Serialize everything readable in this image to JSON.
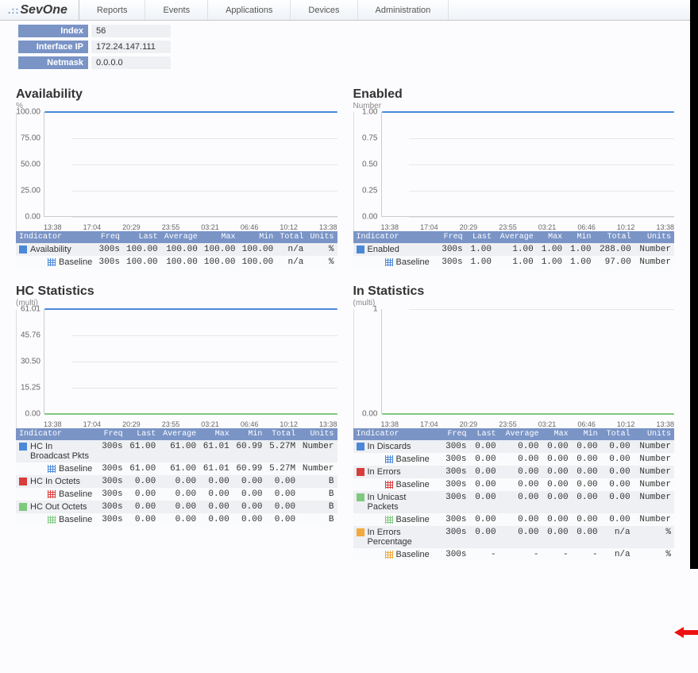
{
  "nav": {
    "brand": "SevOne",
    "items": [
      "Reports",
      "Events",
      "Applications",
      "Devices",
      "Administration"
    ]
  },
  "info": [
    {
      "k": "Index",
      "v": "56"
    },
    {
      "k": "Interface IP",
      "v": "172.24.147.111"
    },
    {
      "k": "Netmask",
      "v": "0.0.0.0"
    }
  ],
  "tableHeaders": [
    "Indicator",
    "Freq",
    "Last",
    "Average",
    "Max",
    "Min",
    "Total",
    "Units"
  ],
  "xticks": [
    "13:38",
    "17:04",
    "20:29",
    "23:55",
    "03:21",
    "06:46",
    "10:12",
    "13:38"
  ],
  "panels": [
    {
      "title": "Availability",
      "sub": "%",
      "yaxis": [
        "100.00",
        "75.00",
        "50.00",
        "25.00",
        "0.00"
      ],
      "lines": [
        {
          "color": "#4b88d8",
          "pos": 0.0,
          "label": "Availability"
        }
      ],
      "rows": [
        {
          "ind": "Availability",
          "sw": "#4b88d8",
          "baseline": false,
          "freq": "300s",
          "last": "100.00",
          "avg": "100.00",
          "max": "100.00",
          "min": "100.00",
          "total": "n/a",
          "units": "%"
        },
        {
          "ind": "Baseline",
          "sw": "#4b88d8",
          "hatch": true,
          "baseline": true,
          "freq": "300s",
          "last": "100.00",
          "avg": "100.00",
          "max": "100.00",
          "min": "100.00",
          "total": "n/a",
          "units": "%"
        }
      ]
    },
    {
      "title": "Enabled",
      "sub": "Number",
      "yaxis": [
        "1.00",
        "0.75",
        "0.50",
        "0.25",
        "0.00"
      ],
      "lines": [
        {
          "color": "#4b88d8",
          "pos": 0.0,
          "label": "Enabled"
        }
      ],
      "rows": [
        {
          "ind": "Enabled",
          "sw": "#4b88d8",
          "baseline": false,
          "freq": "300s",
          "last": "1.00",
          "avg": "1.00",
          "max": "1.00",
          "min": "1.00",
          "total": "288.00",
          "units": "Number"
        },
        {
          "ind": "Baseline",
          "sw": "#4b88d8",
          "hatch": true,
          "baseline": true,
          "freq": "300s",
          "last": "1.00",
          "avg": "1.00",
          "max": "1.00",
          "min": "1.00",
          "total": "97.00",
          "units": "Number"
        }
      ]
    },
    {
      "title": "HC Statistics",
      "sub": "(multi)",
      "yaxis": [
        "61.01",
        "45.76",
        "30.50",
        "15.25",
        "0.00"
      ],
      "lines": [
        {
          "color": "#4b88d8",
          "pos": 0.0,
          "label": "HC In Broadcast Pkts"
        },
        {
          "color": "#7fc97f",
          "pos": 1.0,
          "label": "HC Out Octets"
        }
      ],
      "rows": [
        {
          "ind": "HC In Broadcast Pkts",
          "sw": "#4b88d8",
          "baseline": false,
          "freq": "300s",
          "last": "61.00",
          "avg": "61.00",
          "max": "61.01",
          "min": "60.99",
          "total": "5.27M",
          "units": "Number"
        },
        {
          "ind": "Baseline",
          "sw": "#4b88d8",
          "hatch": true,
          "baseline": true,
          "freq": "300s",
          "last": "61.00",
          "avg": "61.00",
          "max": "61.01",
          "min": "60.99",
          "total": "5.27M",
          "units": "Number"
        },
        {
          "ind": "HC In Octets",
          "sw": "#d93c3c",
          "baseline": false,
          "freq": "300s",
          "last": "0.00",
          "avg": "0.00",
          "max": "0.00",
          "min": "0.00",
          "total": "0.00",
          "units": "B"
        },
        {
          "ind": "Baseline",
          "sw": "#d93c3c",
          "hatch": true,
          "baseline": true,
          "freq": "300s",
          "last": "0.00",
          "avg": "0.00",
          "max": "0.00",
          "min": "0.00",
          "total": "0.00",
          "units": "B"
        },
        {
          "ind": "HC Out Octets",
          "sw": "#7fc97f",
          "baseline": false,
          "freq": "300s",
          "last": "0.00",
          "avg": "0.00",
          "max": "0.00",
          "min": "0.00",
          "total": "0.00",
          "units": "B"
        },
        {
          "ind": "Baseline",
          "sw": "#7fc97f",
          "hatch": true,
          "baseline": true,
          "freq": "300s",
          "last": "0.00",
          "avg": "0.00",
          "max": "0.00",
          "min": "0.00",
          "total": "0.00",
          "units": "B"
        }
      ]
    },
    {
      "title": "In Statistics",
      "sub": "(multi)",
      "yaxis": [
        "1",
        "",
        "",
        "",
        "0.00"
      ],
      "lines": [
        {
          "color": "#7fc97f",
          "pos": 1.0,
          "label": "In Unicast Packets"
        }
      ],
      "rows": [
        {
          "ind": "In Discards",
          "sw": "#4b88d8",
          "baseline": false,
          "freq": "300s",
          "last": "0.00",
          "avg": "0.00",
          "max": "0.00",
          "min": "0.00",
          "total": "0.00",
          "units": "Number"
        },
        {
          "ind": "Baseline",
          "sw": "#4b88d8",
          "hatch": true,
          "baseline": true,
          "freq": "300s",
          "last": "0.00",
          "avg": "0.00",
          "max": "0.00",
          "min": "0.00",
          "total": "0.00",
          "units": "Number"
        },
        {
          "ind": "In Errors",
          "sw": "#d93c3c",
          "baseline": false,
          "freq": "300s",
          "last": "0.00",
          "avg": "0.00",
          "max": "0.00",
          "min": "0.00",
          "total": "0.00",
          "units": "Number"
        },
        {
          "ind": "Baseline",
          "sw": "#d93c3c",
          "hatch": true,
          "baseline": true,
          "freq": "300s",
          "last": "0.00",
          "avg": "0.00",
          "max": "0.00",
          "min": "0.00",
          "total": "0.00",
          "units": "Number"
        },
        {
          "ind": "In Unicast Packets",
          "sw": "#7fc97f",
          "baseline": false,
          "freq": "300s",
          "last": "0.00",
          "avg": "0.00",
          "max": "0.00",
          "min": "0.00",
          "total": "0.00",
          "units": "Number"
        },
        {
          "ind": "Baseline",
          "sw": "#7fc97f",
          "hatch": true,
          "baseline": true,
          "freq": "300s",
          "last": "0.00",
          "avg": "0.00",
          "max": "0.00",
          "min": "0.00",
          "total": "0.00",
          "units": "Number"
        },
        {
          "ind": "In Errors Percentage",
          "sw": "#f2a83b",
          "baseline": false,
          "freq": "300s",
          "last": "0.00",
          "avg": "0.00",
          "max": "0.00",
          "min": "0.00",
          "total": "n/a",
          "units": "%"
        },
        {
          "ind": "Baseline",
          "sw": "#f2a83b",
          "hatch": true,
          "baseline": true,
          "freq": "300s",
          "last": "-",
          "avg": "-",
          "max": "-",
          "min": "-",
          "total": "n/a",
          "units": "%"
        }
      ]
    }
  ],
  "chart_data": [
    {
      "type": "line",
      "title": "Availability",
      "ylabel": "%",
      "ylim": [
        0,
        100
      ],
      "x": [
        "13:38",
        "17:04",
        "20:29",
        "23:55",
        "03:21",
        "06:46",
        "10:12",
        "13:38"
      ],
      "series": [
        {
          "name": "Availability",
          "values": [
            100,
            100,
            100,
            100,
            100,
            100,
            100,
            100
          ]
        }
      ]
    },
    {
      "type": "line",
      "title": "Enabled",
      "ylabel": "Number",
      "ylim": [
        0,
        1
      ],
      "x": [
        "13:38",
        "17:04",
        "20:29",
        "23:55",
        "03:21",
        "06:46",
        "10:12",
        "13:38"
      ],
      "series": [
        {
          "name": "Enabled",
          "values": [
            1,
            1,
            1,
            1,
            1,
            1,
            1,
            1
          ]
        }
      ]
    },
    {
      "type": "line",
      "title": "HC Statistics",
      "ylabel": "(multi)",
      "ylim": [
        0,
        61.01
      ],
      "x": [
        "13:38",
        "17:04",
        "20:29",
        "23:55",
        "03:21",
        "06:46",
        "10:12",
        "13:38"
      ],
      "series": [
        {
          "name": "HC In Broadcast Pkts",
          "values": [
            61,
            61,
            61,
            61,
            61,
            61,
            61,
            61
          ]
        },
        {
          "name": "HC In Octets",
          "values": [
            0,
            0,
            0,
            0,
            0,
            0,
            0,
            0
          ]
        },
        {
          "name": "HC Out Octets",
          "values": [
            0,
            0,
            0,
            0,
            0,
            0,
            0,
            0
          ]
        }
      ]
    },
    {
      "type": "line",
      "title": "In Statistics",
      "ylabel": "(multi)",
      "ylim": [
        0,
        1
      ],
      "x": [
        "13:38",
        "17:04",
        "20:29",
        "23:55",
        "03:21",
        "06:46",
        "10:12",
        "13:38"
      ],
      "series": [
        {
          "name": "In Discards",
          "values": [
            0,
            0,
            0,
            0,
            0,
            0,
            0,
            0
          ]
        },
        {
          "name": "In Errors",
          "values": [
            0,
            0,
            0,
            0,
            0,
            0,
            0,
            0
          ]
        },
        {
          "name": "In Unicast Packets",
          "values": [
            0,
            0,
            0,
            0,
            0,
            0,
            0,
            0
          ]
        },
        {
          "name": "In Errors Percentage",
          "values": [
            0,
            0,
            0,
            0,
            0,
            0,
            0,
            0
          ]
        }
      ]
    }
  ]
}
